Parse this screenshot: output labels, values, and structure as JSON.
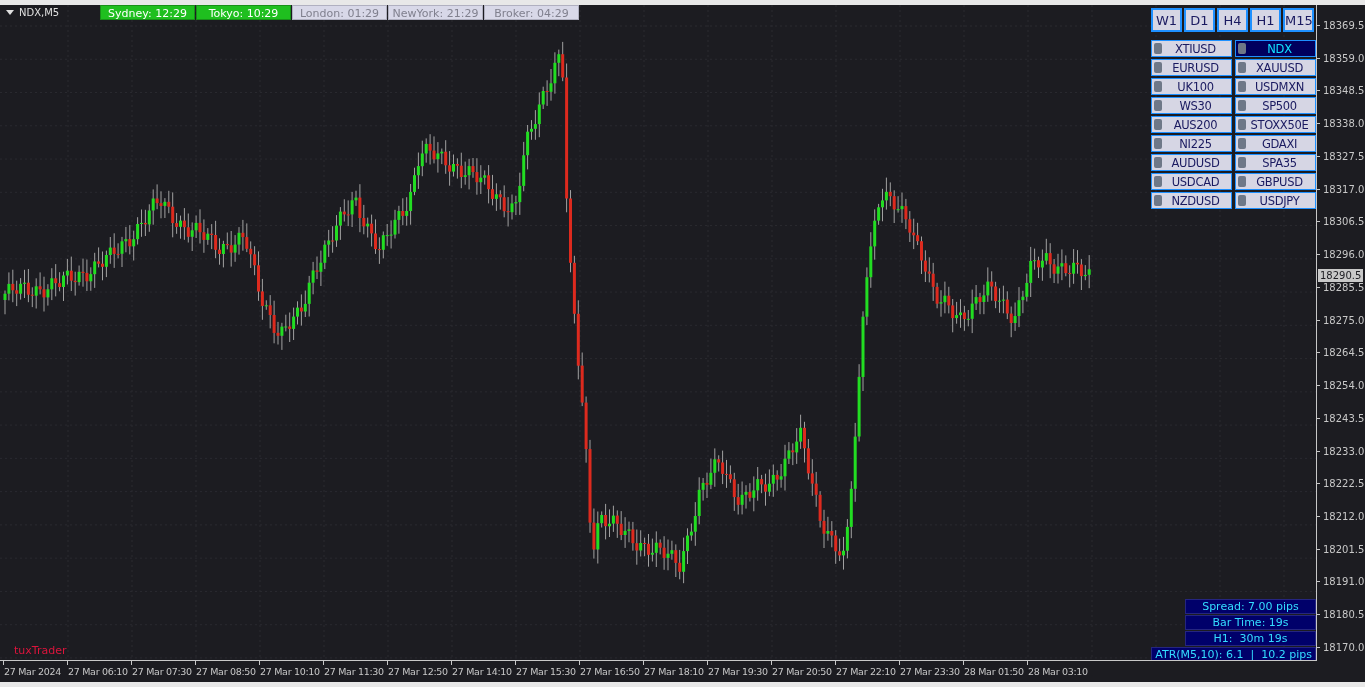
{
  "chart": {
    "symbol_label": "NDX,M5",
    "brand": "tuxTrader"
  },
  "sessions": [
    {
      "label": "Sydney: 12:29",
      "active": true
    },
    {
      "label": "Tokyo: 10:29",
      "active": true
    },
    {
      "label": "London: 01:29",
      "active": false
    },
    {
      "label": "NewYork: 21:29",
      "active": false
    },
    {
      "label": "Broker: 04:29",
      "active": false
    }
  ],
  "timeframes": [
    {
      "label": "W1"
    },
    {
      "label": "D1"
    },
    {
      "label": "H4"
    },
    {
      "label": "H1"
    },
    {
      "label": "M15"
    }
  ],
  "symbols": [
    {
      "label": "XTIUSD",
      "selected": false
    },
    {
      "label": "NDX",
      "selected": true
    },
    {
      "label": "EURUSD",
      "selected": false
    },
    {
      "label": "XAUUSD",
      "selected": false
    },
    {
      "label": "UK100",
      "selected": false
    },
    {
      "label": "USDMXN",
      "selected": false
    },
    {
      "label": "WS30",
      "selected": false
    },
    {
      "label": "SP500",
      "selected": false
    },
    {
      "label": "AUS200",
      "selected": false
    },
    {
      "label": "STOXX50E",
      "selected": false
    },
    {
      "label": "NI225",
      "selected": false
    },
    {
      "label": "GDAXI",
      "selected": false
    },
    {
      "label": "AUDUSD",
      "selected": false
    },
    {
      "label": "SPA35",
      "selected": false
    },
    {
      "label": "USDCAD",
      "selected": false
    },
    {
      "label": "GBPUSD",
      "selected": false
    },
    {
      "label": "NZDUSD",
      "selected": false
    },
    {
      "label": "USDJPY",
      "selected": false
    }
  ],
  "info": [
    "Spread: 7.00 pips",
    "Bar Time: 19s",
    "H1:  30m 19s",
    "ATR(M5,10): 6.1  |  10.2 pips"
  ],
  "price_axis": {
    "ticks": [
      "18369.5",
      "18359.0",
      "18348.5",
      "18338.0",
      "18327.5",
      "18317.0",
      "18306.5",
      "18296.0",
      "18285.5",
      "18275.0",
      "18264.5",
      "18254.0",
      "18243.5",
      "18233.0",
      "18222.5",
      "18212.0",
      "18201.5",
      "18191.0",
      "18180.5",
      "18170.0"
    ],
    "current": "18290.5"
  },
  "time_axis": [
    "27 Mar 2024",
    "27 Mar 06:10",
    "27 Mar 07:30",
    "27 Mar 08:50",
    "27 Mar 10:10",
    "27 Mar 11:30",
    "27 Mar 12:50",
    "27 Mar 14:10",
    "27 Mar 15:30",
    "27 Mar 16:50",
    "27 Mar 18:10",
    "27 Mar 19:30",
    "27 Mar 20:50",
    "27 Mar 22:10",
    "27 Mar 23:30",
    "28 Mar 01:50",
    "28 Mar 03:10"
  ]
}
